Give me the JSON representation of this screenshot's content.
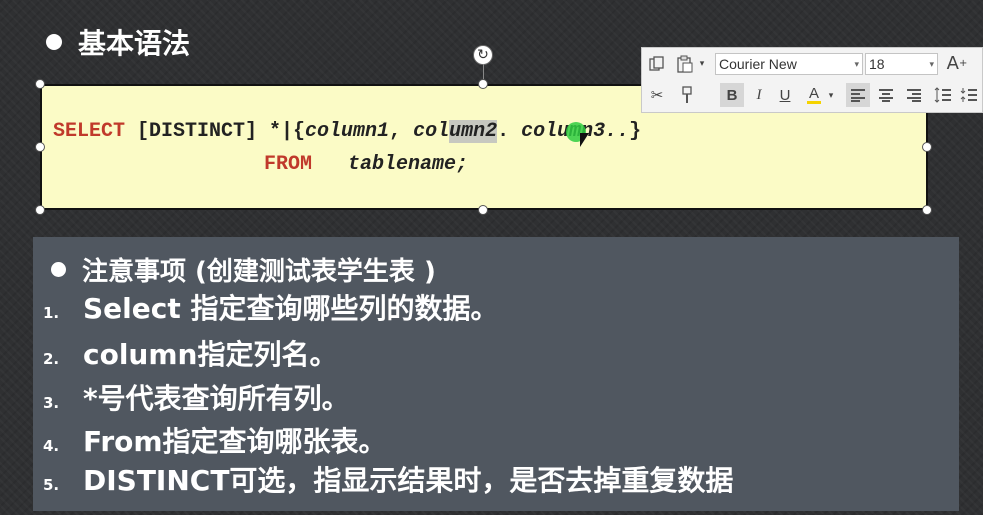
{
  "slide": {
    "title": "基本语法"
  },
  "code": {
    "line1": {
      "kw_select": "SELECT",
      "distinct": " [DISTINCT] *|{",
      "col1": "column1",
      "comma1": ", ",
      "col2_pre": "col",
      "col2_sel": "umn2",
      "dot": ". ",
      "col3": "column3..",
      "close": "}"
    },
    "line2": {
      "kw_from": "FROM",
      "table": "tablename;"
    }
  },
  "toolbar": {
    "font_name": "Courier New",
    "font_size": "18",
    "icons": [
      "copy-icon",
      "paste-icon",
      "grow-font-icon",
      "cut-icon",
      "format-painter-icon",
      "bold-icon",
      "italic-icon",
      "underline-icon",
      "font-color-icon",
      "align-left-icon",
      "align-center-icon",
      "align-right-icon",
      "line-spacing-icon",
      "paragraph-spacing-icon"
    ]
  },
  "notes": {
    "title": "注意事项 (创建测试表学生表 )",
    "items": [
      {
        "num": "1.",
        "text": "Select 指定查询哪些列的数据。"
      },
      {
        "num": "2.",
        "text": "column指定列名。"
      },
      {
        "num": "3.",
        "text": "*号代表查询所有列。"
      },
      {
        "num": "4.",
        "text": "From指定查询哪张表。"
      },
      {
        "num": "5.",
        "text": "DISTINCT可选，指显示结果时，是否去掉重复数据"
      }
    ]
  },
  "colors": {
    "keyword": "#c0392b",
    "code_bg": "#fbfbc6",
    "notes_bg": "#505760",
    "slide_bg": "#2f3032"
  }
}
